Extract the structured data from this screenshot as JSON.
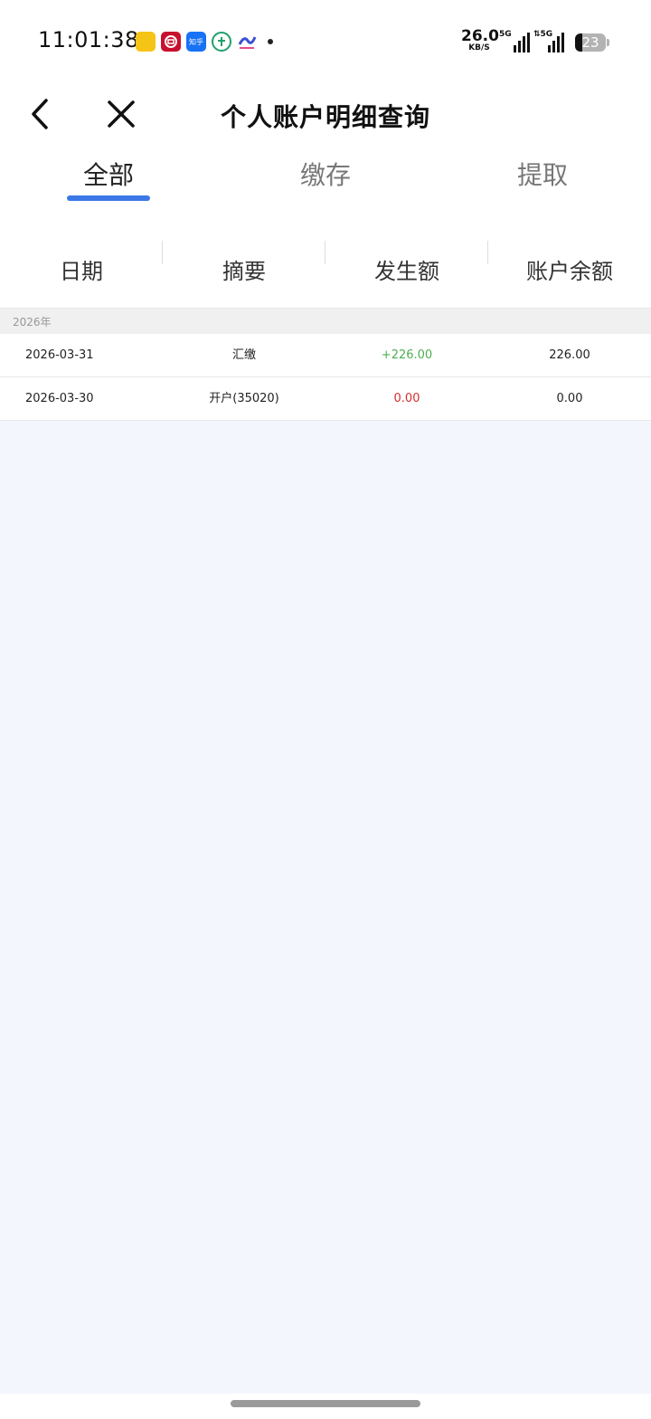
{
  "status_bar": {
    "time": "11:01:38",
    "net_speed_value": "26.0",
    "net_speed_unit": "KB/S",
    "sim1_label": "5G",
    "sim2_label": "⇅5G",
    "battery_level": "23",
    "notification_icons": [
      {
        "name": "app-icon-yellow",
        "label": "",
        "color": "#f6c317"
      },
      {
        "name": "bank-icon",
        "label": "",
        "color": "#c8102e"
      },
      {
        "name": "zhihu-icon",
        "label": "知乎",
        "color": "#1772f6"
      },
      {
        "name": "green-circle-icon",
        "label": "",
        "color": "#20a06b"
      },
      {
        "name": "colorful-app-icon",
        "label": "",
        "color": "#6a5acd"
      }
    ]
  },
  "nav": {
    "title": "个人账户明细查询"
  },
  "tabs": [
    {
      "label": "全部",
      "active": true
    },
    {
      "label": "缴存",
      "active": false
    },
    {
      "label": "提取",
      "active": false
    }
  ],
  "table": {
    "headers": [
      "日期",
      "摘要",
      "发生额",
      "账户余额"
    ],
    "group_label": "2026年",
    "rows": [
      {
        "date": "2026-03-31",
        "summary": "汇缴",
        "amount": "+226.00",
        "balance": "226.00"
      },
      {
        "date": "2026-03-30",
        "summary": "开户(35020)",
        "amount": "0.00",
        "balance": "0.00"
      }
    ]
  },
  "colors": {
    "accent": "#3b78e7",
    "positive": "#4caf50",
    "zero_amount": "#d32f2f",
    "background": "#f3f6fc"
  }
}
